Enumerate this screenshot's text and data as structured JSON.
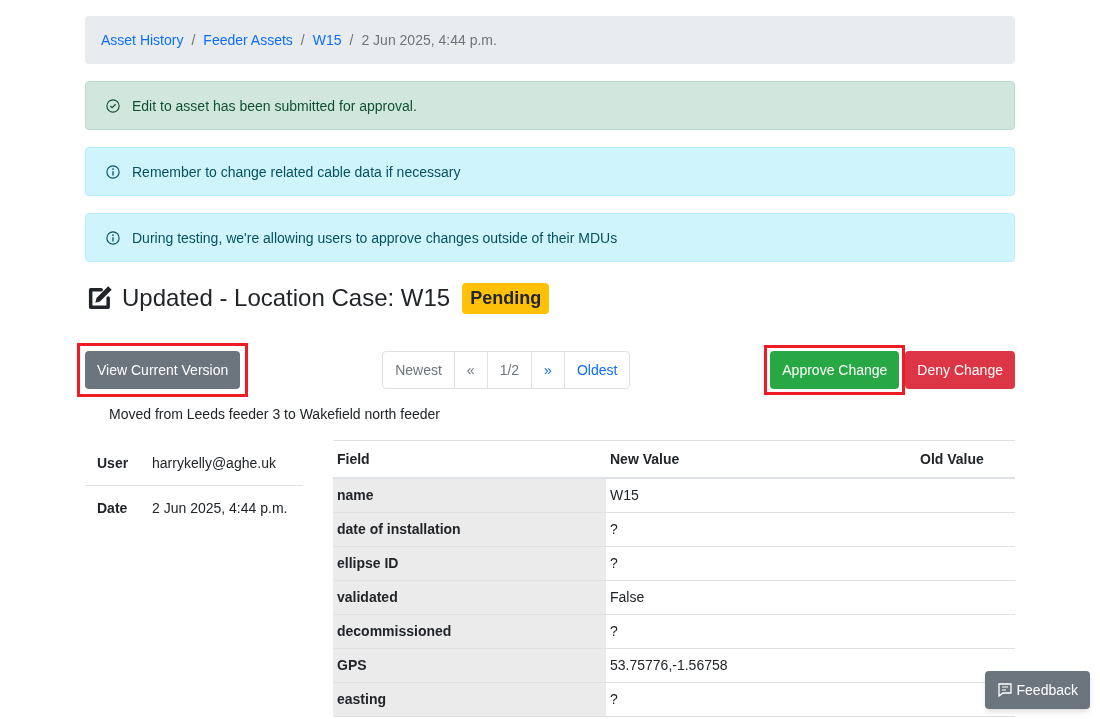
{
  "breadcrumb": [
    {
      "label": "Asset History",
      "link": true
    },
    {
      "separator": "/",
      "label": "Feeder Assets",
      "link": true
    },
    {
      "separator": "/",
      "label": "W15",
      "link": true
    },
    {
      "separator": "/",
      "label": "2 Jun 2025, 4:44 p.m.",
      "link": false
    }
  ],
  "alerts": [
    {
      "kind": "success",
      "text": "Edit to asset has been submitted for approval."
    },
    {
      "kind": "info",
      "text": "Remember to change related cable data if necessary"
    },
    {
      "kind": "info",
      "text": "During testing, we're allowing users to approve changes outside of their MDUs"
    }
  ],
  "heading": {
    "title": "Updated - Location Case: W15",
    "badge": "Pending"
  },
  "view_button": {
    "label": "View Current Version",
    "highlighted": true
  },
  "pagination": [
    {
      "label": "Newest",
      "disabled": true
    },
    {
      "label": "«",
      "disabled": true
    },
    {
      "label": "1/2",
      "disabled": true
    },
    {
      "label": "»",
      "disabled": false
    },
    {
      "label": "Oldest",
      "disabled": false
    }
  ],
  "actions": [
    {
      "label": "Approve Change",
      "kind": "approve",
      "highlighted": true
    },
    {
      "label": "Deny Change",
      "kind": "deny",
      "highlighted": false
    }
  ],
  "description": "Moved from Leeds feeder 3 to Wakefield north feeder",
  "info": [
    {
      "label": "User",
      "value": "harrykelly@aghe.uk"
    },
    {
      "label": "Date",
      "value": "2 Jun 2025, 4:44 p.m."
    }
  ],
  "changes": {
    "columns": [
      "Field",
      "New Value",
      "Old Value"
    ],
    "rows": [
      [
        "name",
        "W15",
        ""
      ],
      [
        "date of installation",
        "?",
        ""
      ],
      [
        "ellipse ID",
        "?",
        ""
      ],
      [
        "validated",
        "False",
        ""
      ],
      [
        "decommissioned",
        "?",
        ""
      ],
      [
        "GPS",
        "53.75776,-1.56758",
        ""
      ],
      [
        "easting",
        "?",
        ""
      ]
    ]
  },
  "feedback_button": "Feedback"
}
